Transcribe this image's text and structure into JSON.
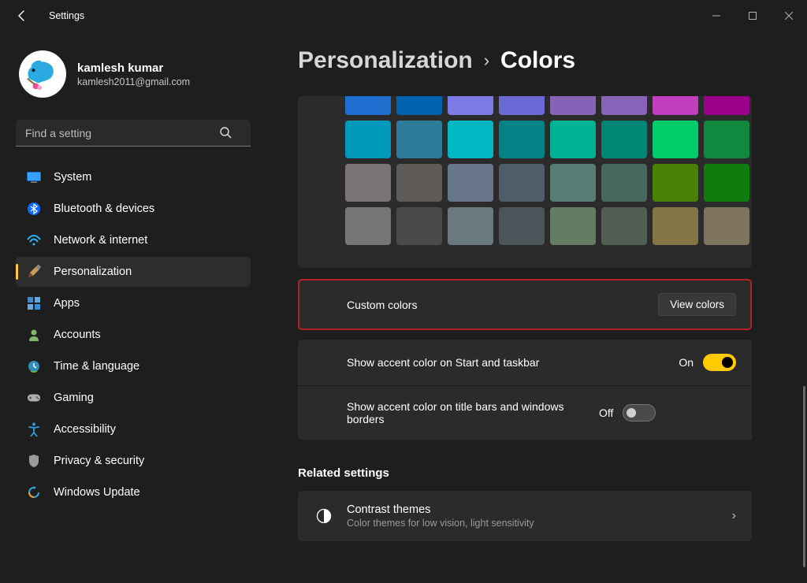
{
  "app_title": "Settings",
  "user": {
    "name": "kamlesh kumar",
    "email": "kamlesh2011@gmail.com"
  },
  "search": {
    "placeholder": "Find a setting"
  },
  "nav": [
    {
      "icon": "system",
      "label": "System"
    },
    {
      "icon": "bluetooth",
      "label": "Bluetooth & devices"
    },
    {
      "icon": "network",
      "label": "Network & internet"
    },
    {
      "icon": "personalize",
      "label": "Personalization",
      "selected": true
    },
    {
      "icon": "apps",
      "label": "Apps"
    },
    {
      "icon": "accounts",
      "label": "Accounts"
    },
    {
      "icon": "time",
      "label": "Time & language"
    },
    {
      "icon": "gaming",
      "label": "Gaming"
    },
    {
      "icon": "access",
      "label": "Accessibility"
    },
    {
      "icon": "privacy",
      "label": "Privacy & security"
    },
    {
      "icon": "update",
      "label": "Windows Update"
    }
  ],
  "breadcrumb": {
    "parent": "Personalization",
    "current": "Colors"
  },
  "colors": [
    [
      "#1f6fd0",
      "#0063b1",
      "#7c7be6",
      "#6b69d6",
      "#8663b7",
      "#8764b8",
      "#c13fbc",
      "#9a0089"
    ],
    [
      "#0099bc",
      "#2d7d9a",
      "#00b7c3",
      "#038387",
      "#00b294",
      "#018574",
      "#00cc6a",
      "#10893e"
    ],
    [
      "#7a7574",
      "#5d5a58",
      "#68768a",
      "#515c6b",
      "#567c73",
      "#486860",
      "#498205",
      "#107c10"
    ],
    [
      "#767676",
      "#4c4a48",
      "#69797e",
      "#4a5459",
      "#647c64",
      "#525e54",
      "#847545",
      "#7e735f"
    ]
  ],
  "settings": {
    "custom_colors_label": "Custom colors",
    "view_colors_btn": "View colors",
    "accent_start_label": "Show accent color on Start and taskbar",
    "accent_start_state": "On",
    "accent_title_label": "Show accent color on title bars and windows borders",
    "accent_title_state": "Off"
  },
  "related": {
    "section_title": "Related settings",
    "title": "Contrast themes",
    "subtitle": "Color themes for low vision, light sensitivity"
  }
}
